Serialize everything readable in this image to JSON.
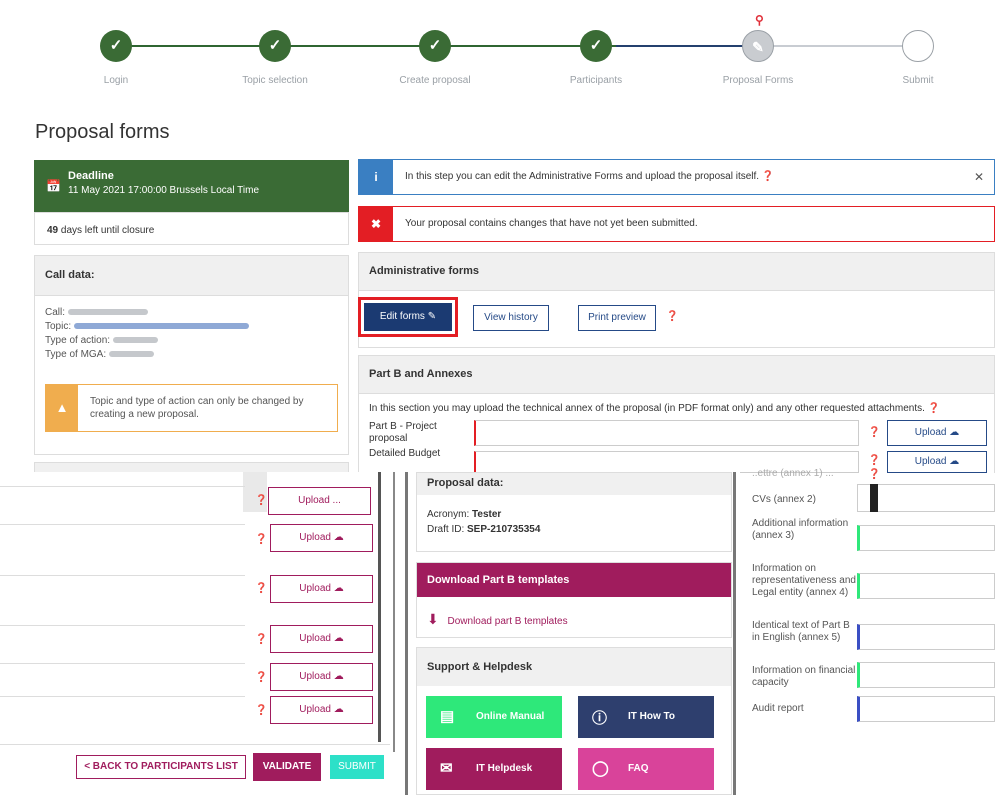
{
  "stepper": {
    "steps": [
      {
        "label": "Login",
        "state": "done"
      },
      {
        "label": "Topic selection",
        "state": "done"
      },
      {
        "label": "Create proposal",
        "state": "done"
      },
      {
        "label": "Participants",
        "state": "done"
      },
      {
        "label": "Proposal Forms",
        "state": "current"
      },
      {
        "label": "Submit",
        "state": "todo"
      }
    ]
  },
  "page_title": "Proposal forms",
  "deadline": {
    "title": "Deadline",
    "date": "11 May 2021 17:00:00 Brussels Local Time",
    "days_count": "49",
    "days_text": "days left until closure"
  },
  "call_data": {
    "title": "Call data:",
    "call_label": "Call:",
    "topic_label": "Topic:",
    "type_action_label": "Type of action:",
    "type_mga_label": "Type of MGA:",
    "warning": "Topic and type of action can only be changed by creating a new proposal."
  },
  "alerts": {
    "info": "In this step you can edit the Administrative Forms and upload the proposal itself.",
    "error": "Your proposal contains changes that have not yet been submitted."
  },
  "admin_forms": {
    "title": "Administrative forms",
    "edit_label": "Edit forms",
    "history_label": "View history",
    "preview_label": "Print preview"
  },
  "part_b": {
    "title": "Part B and Annexes",
    "intro": "In this section you may upload the technical annex of the proposal (in PDF format only) and any other requested attachments.",
    "row1_label": "Part B - Project proposal",
    "row2_label": "Detailed Budget",
    "upload_label": "Upload"
  },
  "left_uploads": {
    "first_label": "Upload",
    "overlap_label": "Upload ...",
    "labels": [
      "Upload",
      "Upload",
      "Upload",
      "Upload",
      "Upload"
    ]
  },
  "bottom_buttons": {
    "back": "< BACK TO PARTICIPANTS LIST",
    "validate": "VALIDATE",
    "submit": "SUBMIT"
  },
  "proposal_data": {
    "title": "Proposal data:",
    "acronym_label": "Acronym:",
    "acronym": "Tester",
    "draft_label": "Draft ID:",
    "draft_id": "SEP-210735354"
  },
  "templates": {
    "title": "Download Part B templates",
    "link": "Download part B templates"
  },
  "support": {
    "title": "Support & Helpdesk",
    "tiles": [
      {
        "label": "Online Manual",
        "icon": "book-icon",
        "color": "#2ee87a"
      },
      {
        "label": "IT How To",
        "icon": "info-icon",
        "color": "#2e3f6e"
      },
      {
        "label": "IT Helpdesk",
        "icon": "mail-icon",
        "color": "#a01c5d"
      },
      {
        "label": "FAQ",
        "icon": "question-icon",
        "color": "#d9439a"
      }
    ]
  },
  "annexes": {
    "partial_top": "..ettre (annex 1) ...",
    "items": [
      {
        "label": "CVs (annex 2)",
        "bar": "#222222"
      },
      {
        "label": "Additional information (annex 3)",
        "bar": "#2ee87a"
      },
      {
        "label": "Information on representativeness and Legal entity (annex 4)",
        "bar": "#2ee87a"
      },
      {
        "label": "Identical text of Part B in English (annex 5)",
        "bar": "#3b4fc4"
      },
      {
        "label": "Information on financial capacity",
        "bar": "#2ee87a"
      },
      {
        "label": "Audit report",
        "bar": "#3b4fc4"
      }
    ]
  },
  "colors": {
    "green": "#3a6b35",
    "navy": "#1b3a72",
    "magenta": "#a01c5d",
    "red": "#e31e24",
    "info_blue": "#3a7fc2"
  }
}
